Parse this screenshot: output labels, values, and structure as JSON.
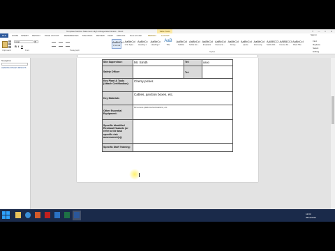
{
  "window": {
    "title": "Template Method Statement High Voltage Electricians - Word",
    "context_tab_group": "Table Tools",
    "buttons": [
      "?",
      "—",
      "□",
      "✕"
    ]
  },
  "ribbon_tabs": [
    "FILE",
    "HOME",
    "INSERT",
    "DESIGN",
    "PAGE LAYOUT",
    "REFERENCES",
    "MAILINGS",
    "REVIEW",
    "VIEW",
    "ADD-INS",
    "New Acrobat",
    "DESIGN",
    "LAYOUT"
  ],
  "account": {
    "sign_in": "Sign in"
  },
  "ribbon": {
    "clipboard": {
      "paste_label": "Paste",
      "caption": "Clipboard"
    },
    "font": {
      "family": "Arial",
      "size": "8",
      "bold": "B",
      "italic": "I",
      "underline": "U",
      "caption": "Font"
    },
    "paragraph": {
      "caption": "Paragraph"
    },
    "styles": {
      "caption": "Styles",
      "items": [
        {
          "preview": "AaBbCcI",
          "name": "1 Normal"
        },
        {
          "preview": "AaBbCcI",
          "name": "1 No Spac..."
        },
        {
          "preview": "AaBbCc",
          "name": "Heading 1"
        },
        {
          "preview": "AaBbCc",
          "name": "Heading 2"
        },
        {
          "preview": "AaB",
          "name": "Title"
        },
        {
          "preview": "AaBbCcI",
          "name": "Subtitle"
        },
        {
          "preview": "AaBbCcI",
          "name": "Subtle Em..."
        },
        {
          "preview": "AaBbCcI",
          "name": "Emphasis"
        },
        {
          "preview": "AaBbCcI",
          "name": "Intense E..."
        },
        {
          "preview": "AaBbCcI",
          "name": "Strong"
        },
        {
          "preview": "AaBbCcI",
          "name": "Quote"
        },
        {
          "preview": "AaBbCcI",
          "name": "Intense Q..."
        },
        {
          "preview": "AABBCCI",
          "name": "Subtle Ref..."
        },
        {
          "preview": "AABBCCI",
          "name": "Intense Re..."
        },
        {
          "preview": "AaBbCcI",
          "name": "Book Title"
        }
      ]
    },
    "editing": {
      "find": "Find",
      "replace": "Replace",
      "select": "Select",
      "caption": "Editing"
    }
  },
  "nav_pane": {
    "header": "Navigation",
    "tabs": "HEADINGS  PAGES  RESULTS"
  },
  "document": {
    "rows": [
      {
        "label": "Site Supervisor:",
        "value": "Mr. Smith",
        "extra_label": "Tel:",
        "extra_value": "0800"
      },
      {
        "label": "Safety Officer",
        "value": "",
        "extra_label": "Tel:",
        "extra_value": ""
      },
      {
        "label": "Key Plant & Tools (Attach Certification):",
        "value": "Cherry picker."
      },
      {
        "label": "Key Materials",
        "value": "Cables, junction boxes, etc."
      },
      {
        "label": "Other Essential Equipment:",
        "value": "Pic access platforms/workstations, etc."
      },
      {
        "label": "Specific Identified Residual Hazards (or refer to the task specific risk assessment(s)):",
        "value": ""
      },
      {
        "label": "Specific Staff Training:",
        "value": ""
      }
    ]
  },
  "status_bar": {
    "page": "PAGE 2 OF 15",
    "words": "3 OF 2500 WORDS",
    "zoom": "100%"
  },
  "taskbar": {
    "time": "12:03",
    "date": "05/12/2014"
  },
  "colors": {
    "word_blue": "#2b579a",
    "table_label_bg": "#d9d9d9",
    "taskbar": "#1a2a4a",
    "context_tab": "#fbe9a6"
  }
}
